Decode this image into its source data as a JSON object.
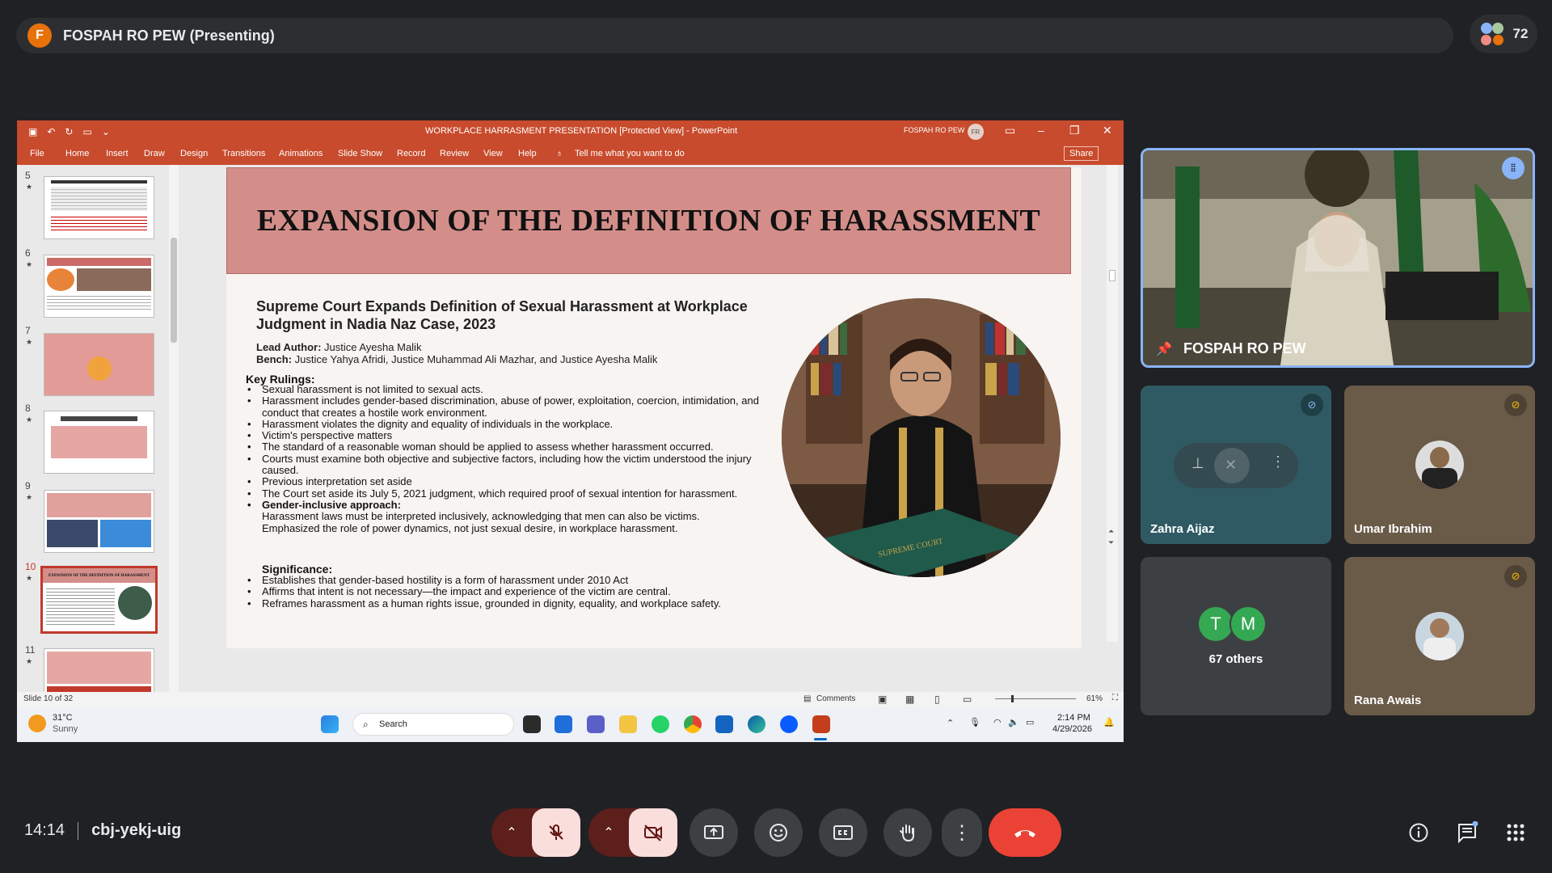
{
  "meet": {
    "presenter_initial": "F",
    "presenter_label": "FOSPAH RO PEW (Presenting)",
    "participant_count": "72",
    "time": "14:14",
    "meeting_code": "cbj-yekj-uig"
  },
  "ppt": {
    "window_title": "WORKPLACE HARRASMENT PRESENTATION [Protected View]  -  PowerPoint",
    "user_name": "FOSPAH RO PEW",
    "user_initials": "FR",
    "tabs": [
      "File",
      "Home",
      "Insert",
      "Draw",
      "Design",
      "Transitions",
      "Animations",
      "Slide Show",
      "Record",
      "Review",
      "View",
      "Help"
    ],
    "tell_me": "Tell me what you want to do",
    "share_label": "Share",
    "thumbnails": [
      "5",
      "6",
      "7",
      "8",
      "9",
      "10",
      "11"
    ],
    "thumb10_title": "EXPANSION OF THE DEFINITION OF HARASSMENT",
    "status_slide": "Slide 10 of 32",
    "status_comments": "Comments",
    "zoom": "61%"
  },
  "slide": {
    "title": "EXPANSION OF THE DEFINITION OF HARASSMENT",
    "subtitle": "Supreme Court Expands Definition of Sexual Harassment at Workplace  Judgment in Nadia Naz Case, 2023",
    "lead_label": "Lead Author:",
    "lead_value": " Justice Ayesha Malik",
    "bench_label": "Bench:",
    "bench_value": " Justice Yahya Afridi, Justice Muhammad Ali Mazhar, and Justice Ayesha Malik",
    "rulings_heading": "Key Rulings:",
    "rulings": [
      {
        "text": "Sexual harassment is not limited to sexual acts.",
        "style": "bullet"
      },
      {
        "text": "Harassment includes gender-based discrimination, abuse of power, exploitation, coercion, intimidation, and conduct that creates a hostile work environment.",
        "style": "bullet"
      },
      {
        "text": "Harassment violates the dignity and equality of individuals in the workplace.",
        "style": "bullet"
      },
      {
        "text": "Victim's perspective matters",
        "style": "bullet"
      },
      {
        "text": "The standard of a reasonable woman should be applied to assess whether harassment occurred.",
        "style": "bullet"
      },
      {
        "text": "Courts must examine both objective and subjective factors, including how the victim understood the injury caused.",
        "style": "bullet"
      },
      {
        "text": "Previous interpretation set aside",
        "style": "bullet"
      },
      {
        "text": "The Court set aside its July 5, 2021 judgment, which required proof of sexual intention for harassment.",
        "style": "bullet"
      },
      {
        "text": "Gender-inclusive approach:",
        "style": "bold"
      },
      {
        "text": "Harassment laws must be interpreted inclusively, acknowledging that men can also be victims.",
        "style": "plain"
      },
      {
        "text": "Emphasized the role of power dynamics, not just sexual desire, in workplace harassment.",
        "style": "plain"
      }
    ],
    "significance_heading": "Significance:",
    "significance": [
      "Establishes that gender-based hostility is a form of harassment under 2010 Act",
      "Affirms that intent is not necessary—the impact and experience of the victim are central.",
      "Reframes harassment as a human rights issue, grounded in dignity, equality, and workplace safety."
    ],
    "photo_caption": "SUPREME COURT"
  },
  "taskbar": {
    "temperature": "31°C",
    "weather": "Sunny",
    "search_placeholder": "Search",
    "clock_time": "2:14 PM",
    "clock_date": "4/29/2026"
  },
  "tiles": {
    "main_name": "FOSPAH RO PEW",
    "zahra": "Zahra Aijaz",
    "umar": "Umar Ibrahim",
    "others_count": "67 others",
    "others_letters": [
      "T",
      "M"
    ],
    "rana": "Rana Awais"
  },
  "colors": {
    "meet_bg": "#202124",
    "ppt_accent": "#c84b2d",
    "slide_header": "#d48e8a",
    "end_call": "#ea4335",
    "muted_ctrl": "#f9dedc"
  }
}
